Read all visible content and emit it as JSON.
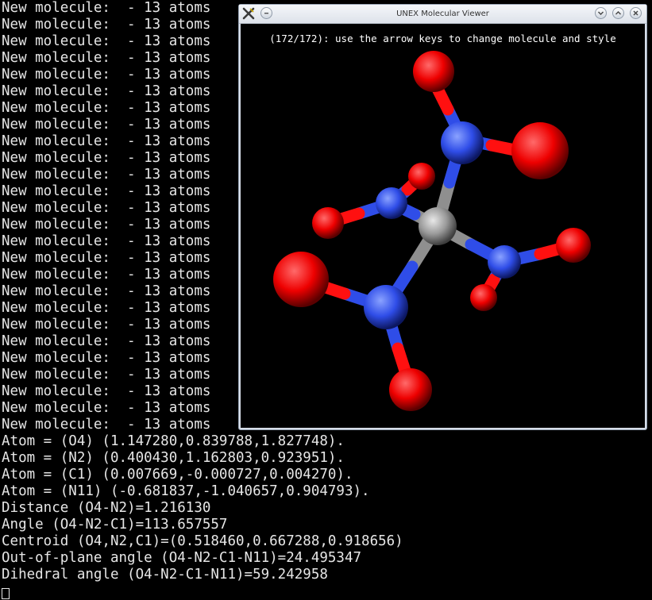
{
  "terminal": {
    "molecule_lines": [
      "New molecule:  - 13 atoms",
      "New molecule:  - 13 atoms",
      "New molecule:  - 13 atoms",
      "New molecule:  - 13 atoms",
      "New molecule:  - 13 atoms",
      "New molecule:  - 13 atoms",
      "New molecule:  - 13 atoms",
      "New molecule:  - 13 atoms",
      "New molecule:  - 13 atoms",
      "New molecule:  - 13 atoms",
      "New molecule:  - 13 atoms",
      "New molecule:  - 13 atoms",
      "New molecule:  - 13 atoms",
      "New molecule:  - 13 atoms",
      "New molecule:  - 13 atoms",
      "New molecule:  - 13 atoms",
      "New molecule:  - 13 atoms",
      "New molecule:  - 13 atoms",
      "New molecule:  - 13 atoms",
      "New molecule:  - 13 atoms",
      "New molecule:  - 13 atoms",
      "New molecule:  - 13 atoms",
      "New molecule:  - 13 atoms",
      "New molecule:  - 13 atoms",
      "New molecule:  - 13 atoms",
      "New molecule:  - 13 atoms"
    ],
    "output_lines": [
      "Atom = (O4) (1.147280,0.839788,1.827748).",
      "Atom = (N2) (0.400430,1.162803,0.923951).",
      "Atom = (C1) (0.007669,-0.000727,0.004270).",
      "Atom = (N11) (-0.681837,-1.040657,0.904793).",
      "Distance (O4-N2)=1.216130",
      "Angle (O4-N2-C1)=113.657557",
      "Centroid (O4,N2,C1)=(0.518460,0.667288,0.918656)",
      "Out-of-plane angle (O4-N2-C1-N11)=24.495347",
      "Dihedral angle (O4-N2-C1-N11)=59.242958"
    ]
  },
  "viewer": {
    "title": "UNEX Molecular Viewer",
    "status": "(172/172): use the arrow keys to change molecule and style",
    "icons": {
      "app": "unex-x-icon",
      "menu": "window-menu-icon",
      "minimize": "chevron-down-icon",
      "maximize": "chevron-up-icon",
      "close": "close-icon"
    },
    "colors": {
      "carbon": "#9a9a9a",
      "nitrogen": "#2f4de8",
      "oxygen": "#ff1010",
      "background": "#000000"
    }
  }
}
